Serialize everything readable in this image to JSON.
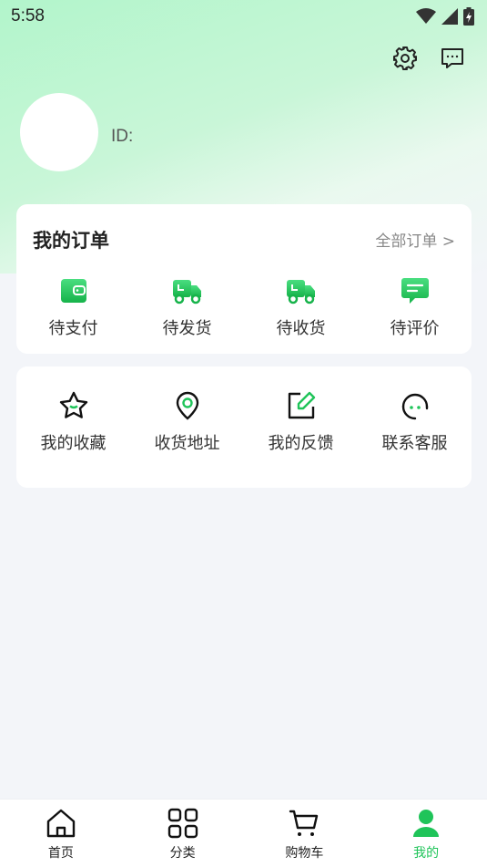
{
  "status_bar": {
    "time": "5:58"
  },
  "profile": {
    "id_label": "ID:"
  },
  "orders": {
    "title": "我的订单",
    "all_link": "全部订单 >",
    "items": [
      {
        "label": "待支付",
        "icon": "wallet-icon"
      },
      {
        "label": "待发货",
        "icon": "truck-icon"
      },
      {
        "label": "待收货",
        "icon": "delivery-truck-icon"
      },
      {
        "label": "待评价",
        "icon": "review-icon"
      }
    ]
  },
  "services": {
    "items": [
      {
        "label": "我的收藏",
        "icon": "star-icon"
      },
      {
        "label": "收货地址",
        "icon": "location-icon"
      },
      {
        "label": "我的反馈",
        "icon": "edit-icon"
      },
      {
        "label": "联系客服",
        "icon": "headset-icon"
      }
    ]
  },
  "tabbar": {
    "items": [
      {
        "label": "首页",
        "icon": "home-icon"
      },
      {
        "label": "分类",
        "icon": "grid-icon"
      },
      {
        "label": "购物车",
        "icon": "cart-icon"
      },
      {
        "label": "我的",
        "icon": "user-icon",
        "active": true
      }
    ]
  },
  "colors": {
    "accent": "#1fc459",
    "background": "#f3f5f9"
  }
}
